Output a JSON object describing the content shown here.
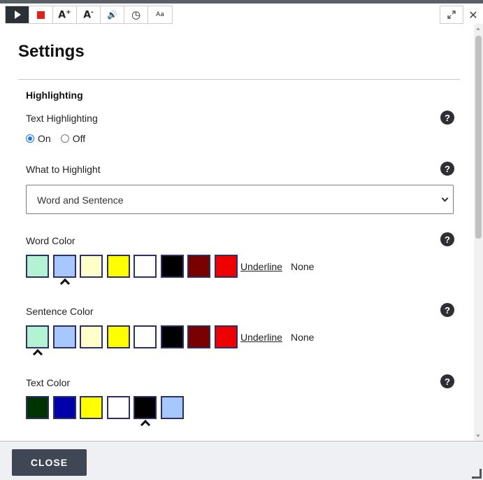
{
  "toolbar": {
    "buttons": [
      {
        "name": "play-button",
        "icon": "play-icon"
      },
      {
        "name": "stop-button",
        "icon": "stop-icon"
      },
      {
        "name": "increase-font-button",
        "label": "A",
        "sup": "+"
      },
      {
        "name": "decrease-font-button",
        "label": "A",
        "sup": "-"
      },
      {
        "name": "volume-button",
        "label": "🔊"
      },
      {
        "name": "speed-button",
        "label": "◷"
      },
      {
        "name": "text-settings-button",
        "label": "Aa"
      }
    ],
    "close_symbol": "✕"
  },
  "settings": {
    "title": "Settings",
    "section": "Highlighting",
    "text_highlighting": {
      "label": "Text Highlighting",
      "on_label": "On",
      "off_label": "Off",
      "selected": "On"
    },
    "what_to_highlight": {
      "label": "What to Highlight",
      "value": "Word and Sentence"
    },
    "word_color": {
      "label": "Word Color",
      "swatches": [
        "#b3f2d2",
        "#a6c8ff",
        "#ffffcc",
        "#ffff00",
        "#ffffff",
        "#000000",
        "#7a0000",
        "#ee0000"
      ],
      "selected_index": 1,
      "underline_label": "Underline",
      "none_label": "None"
    },
    "sentence_color": {
      "label": "Sentence Color",
      "swatches": [
        "#b3f2d2",
        "#a6c8ff",
        "#ffffcc",
        "#ffff00",
        "#ffffff",
        "#000000",
        "#7a0000",
        "#ee0000"
      ],
      "selected_index": 0,
      "underline_label": "Underline",
      "none_label": "None"
    },
    "text_color": {
      "label": "Text Color",
      "swatches": [
        "#003300",
        "#0000aa",
        "#ffff00",
        "#ffffff",
        "#000000",
        "#a6c8ff"
      ],
      "selected_index": 4
    },
    "help_symbol": "?"
  },
  "footer": {
    "close_label": "CLOSE"
  }
}
